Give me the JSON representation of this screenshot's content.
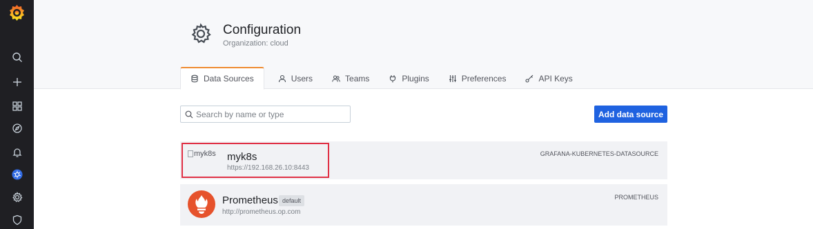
{
  "header": {
    "title": "Configuration",
    "subtitle": "Organization: cloud",
    "icon": "gear-icon"
  },
  "tabs": [
    {
      "label": "Data Sources",
      "icon": "database-icon",
      "active": true
    },
    {
      "label": "Users",
      "icon": "user-icon",
      "active": false
    },
    {
      "label": "Teams",
      "icon": "users-icon",
      "active": false
    },
    {
      "label": "Plugins",
      "icon": "plug-icon",
      "active": false
    },
    {
      "label": "Preferences",
      "icon": "sliders-icon",
      "active": false
    },
    {
      "label": "API Keys",
      "icon": "key-icon",
      "active": false
    }
  ],
  "search": {
    "placeholder": "Search by name or type",
    "value": ""
  },
  "add_button": {
    "label": "Add data source"
  },
  "datasources": [
    {
      "name": "myk8s",
      "image_alt": "myk8s",
      "url": "https://192.168.26.10:8443",
      "type": "GRAFANA-KUBERNETES-DATASOURCE",
      "highlighted": true
    },
    {
      "name": "Prometheus",
      "badge": "default",
      "url": "http://prometheus.op.com",
      "type": "PROMETHEUS"
    }
  ],
  "sidebar": {
    "items": [
      "search-icon",
      "plus-icon",
      "dashboards-icon",
      "explore-icon",
      "alerting-icon",
      "kubernetes-icon",
      "gear-icon",
      "shield-icon"
    ]
  },
  "colors": {
    "accent": "#ef8b31",
    "primary_button": "#1f62e0",
    "highlight_border": "#e02f44",
    "sidebar_bg": "#1f1f23"
  }
}
